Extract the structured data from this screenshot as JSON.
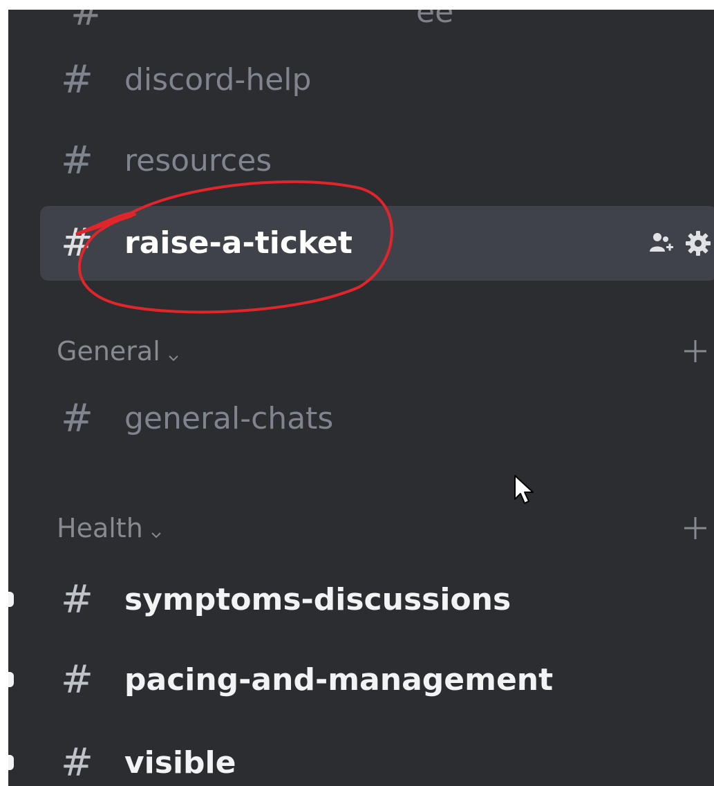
{
  "partial_top": {
    "hash": "#",
    "name_fragment": "ee"
  },
  "channels_top": [
    {
      "name": "discord-help",
      "state": "muted"
    },
    {
      "name": "resources",
      "state": "muted"
    },
    {
      "name": "raise-a-ticket",
      "state": "selected"
    }
  ],
  "selected_actions": {
    "invite_icon": "add-member-icon",
    "settings_icon": "gear-icon"
  },
  "categories": [
    {
      "label": "General",
      "add_icon": "plus-icon",
      "channels": [
        {
          "name": "general-chats",
          "state": "muted"
        }
      ]
    },
    {
      "label": "Health",
      "add_icon": "plus-icon",
      "channels": [
        {
          "name": "symptoms-discussions",
          "state": "unread"
        },
        {
          "name": "pacing-and-management",
          "state": "unread"
        },
        {
          "name": "visible",
          "state": "unread"
        }
      ]
    }
  ],
  "hash_glyph": "#",
  "colors": {
    "sidebar_bg": "#2b2d31",
    "selected_bg": "#404249",
    "muted_text": "#80848e",
    "unread_text": "#f2f3f5",
    "category_text": "#878a91",
    "annotation": "#e0262b"
  }
}
